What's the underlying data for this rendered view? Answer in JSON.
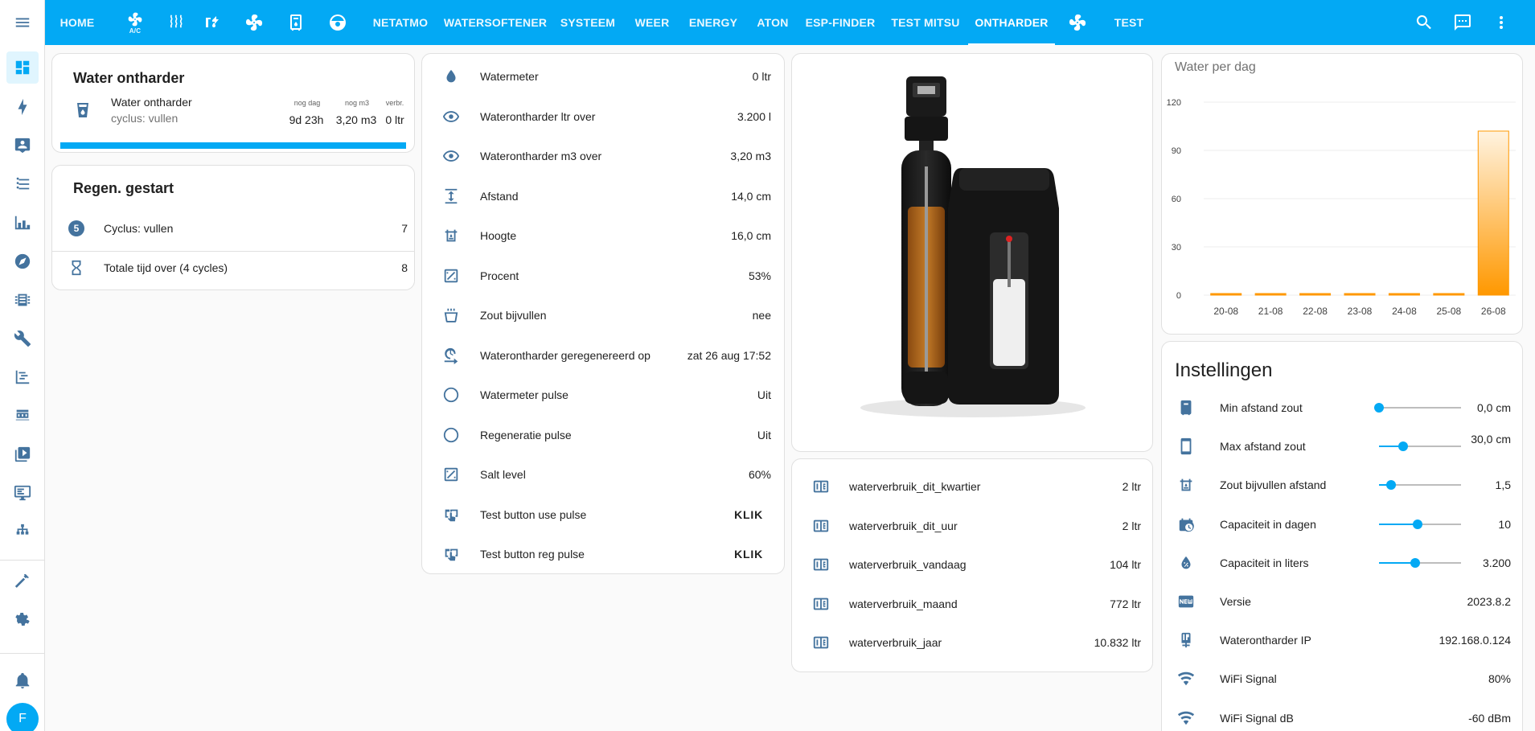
{
  "topbar": {
    "tabs": [
      {
        "label": "HOME",
        "icon": null
      },
      {
        "label": "",
        "icon": "fan-ac-icon"
      },
      {
        "label": "",
        "icon": "heat-wave-icon"
      },
      {
        "label": "",
        "icon": "water-pump-icon"
      },
      {
        "label": "",
        "icon": "fan-icon"
      },
      {
        "label": "",
        "icon": "water-boiler-icon"
      },
      {
        "label": "",
        "icon": "robot-vacuum-icon"
      },
      {
        "label": "NETATMO",
        "icon": null
      },
      {
        "label": "WATERSOFTENER",
        "icon": null
      },
      {
        "label": "SYSTEEM",
        "icon": null
      },
      {
        "label": "WEER",
        "icon": null
      },
      {
        "label": "ENERGY",
        "icon": null
      },
      {
        "label": "ATON",
        "icon": null
      },
      {
        "label": "ESP-FINDER",
        "icon": null
      },
      {
        "label": "TEST MITSU",
        "icon": null
      },
      {
        "label": "ONTHARDER",
        "icon": null
      },
      {
        "label": "",
        "icon": "fan-icon"
      },
      {
        "label": "TEST",
        "icon": null
      }
    ],
    "active_tab": "ONTHARDER",
    "ac_icon_text": "A/C"
  },
  "sidebar": {
    "user_initial": "F"
  },
  "ontharder_card": {
    "title": "Water ontharder",
    "entity_name": "Water ontharder",
    "entity_state": "cyclus: vullen",
    "col1_header": "nog dag",
    "col1_value": "9d 23h",
    "col2_header": "nog m3",
    "col2_value": "3,20 m3",
    "col3_header": "verbr.",
    "col3_value": "0 ltr",
    "progress": 1.0
  },
  "regen_card": {
    "title": "Regen. gestart",
    "rows": [
      {
        "badge": "5",
        "label": "Cyclus: vullen",
        "value": "7"
      },
      {
        "label": "Totale tijd over (4 cycles)",
        "value": "8"
      }
    ]
  },
  "entities_card": {
    "rows": [
      {
        "icon": "water-icon",
        "label": "Watermeter",
        "value": "0 ltr"
      },
      {
        "icon": "eye-icon",
        "label": "Waterontharder ltr over",
        "value": "3.200 l"
      },
      {
        "icon": "eye-icon",
        "label": "Waterontharder m3 over",
        "value": "3,20 m3"
      },
      {
        "icon": "arrow-expand-vertical-icon",
        "label": "Afstand",
        "value": "14,0 cm"
      },
      {
        "icon": "car-coolant-level-icon",
        "label": "Hoogte",
        "value": "16,0 cm"
      },
      {
        "icon": "percent-box-icon",
        "label": "Procent",
        "value": "53%"
      },
      {
        "icon": "bucket-icon",
        "label": "Zout bijvullen",
        "value": "nee"
      },
      {
        "icon": "clock-arrow-icon",
        "label": "Waterontharder geregenereerd op",
        "value": "zat 26 aug 17:52"
      },
      {
        "icon": "circle-outline-icon",
        "label": "Watermeter pulse",
        "value": "Uit"
      },
      {
        "icon": "circle-outline-icon",
        "label": "Regeneratie pulse",
        "value": "Uit"
      },
      {
        "icon": "percent-box-icon",
        "label": "Salt level",
        "value": "60%"
      },
      {
        "icon": "gesture-tap-button-icon",
        "label": "Test button use pulse",
        "value": "KLIK"
      },
      {
        "icon": "gesture-tap-button-icon",
        "label": "Test button reg pulse",
        "value": "KLIK"
      }
    ]
  },
  "usage_card": {
    "rows": [
      {
        "icon": "counter-icon",
        "label": "waterverbruik_dit_kwartier",
        "value": "2 ltr"
      },
      {
        "icon": "counter-icon",
        "label": "waterverbruik_dit_uur",
        "value": "2 ltr"
      },
      {
        "icon": "counter-icon",
        "label": "waterverbruik_vandaag",
        "value": "104 ltr"
      },
      {
        "icon": "counter-icon",
        "label": "waterverbruik_maand",
        "value": "772 ltr"
      },
      {
        "icon": "counter-icon",
        "label": "waterverbruik_jaar",
        "value": "10.832 ltr"
      }
    ]
  },
  "chart_data": {
    "type": "bar",
    "title": "Water per dag",
    "categories": [
      "20-08",
      "21-08",
      "22-08",
      "23-08",
      "24-08",
      "25-08",
      "26-08"
    ],
    "values": [
      0,
      0,
      0,
      0,
      0,
      0,
      102
    ],
    "ylim": [
      0,
      120
    ],
    "yticks": [
      0,
      30,
      60,
      90,
      120
    ],
    "grid": true,
    "color": "#ff9800"
  },
  "settings_card": {
    "title": "Instellingen",
    "rows": [
      {
        "icon": "water-boiler-icon",
        "label": "Min afstand zout",
        "slider": 0.0,
        "value": "0,0 cm"
      },
      {
        "icon": "cellphone-icon",
        "label": "Max afstand zout",
        "slider": 0.29,
        "value": "30,0 cm"
      },
      {
        "icon": "car-coolant-level-icon",
        "label": "Zout bijvullen afstand",
        "slider": 0.15,
        "value": "1,5"
      },
      {
        "icon": "calendar-clock-icon",
        "label": "Capaciteit in dagen",
        "slider": 0.47,
        "value": "10"
      },
      {
        "icon": "water-percent-icon",
        "label": "Capaciteit in liters",
        "slider": 0.44,
        "value": "3.200"
      },
      {
        "icon": "new-box-icon",
        "label": "Versie",
        "value": "2023.8.2"
      },
      {
        "icon": "ip-network-icon",
        "label": "Waterontharder IP",
        "value": "192.168.0.124"
      },
      {
        "icon": "wifi-icon",
        "label": "WiFi Signal",
        "value": "80%"
      },
      {
        "icon": "wifi-icon",
        "label": "WiFi Signal dB",
        "value": "-60 dBm"
      }
    ]
  },
  "colors": {
    "primary": "#03a9f4",
    "icon": "#44739e",
    "bar": "#ff9800"
  }
}
